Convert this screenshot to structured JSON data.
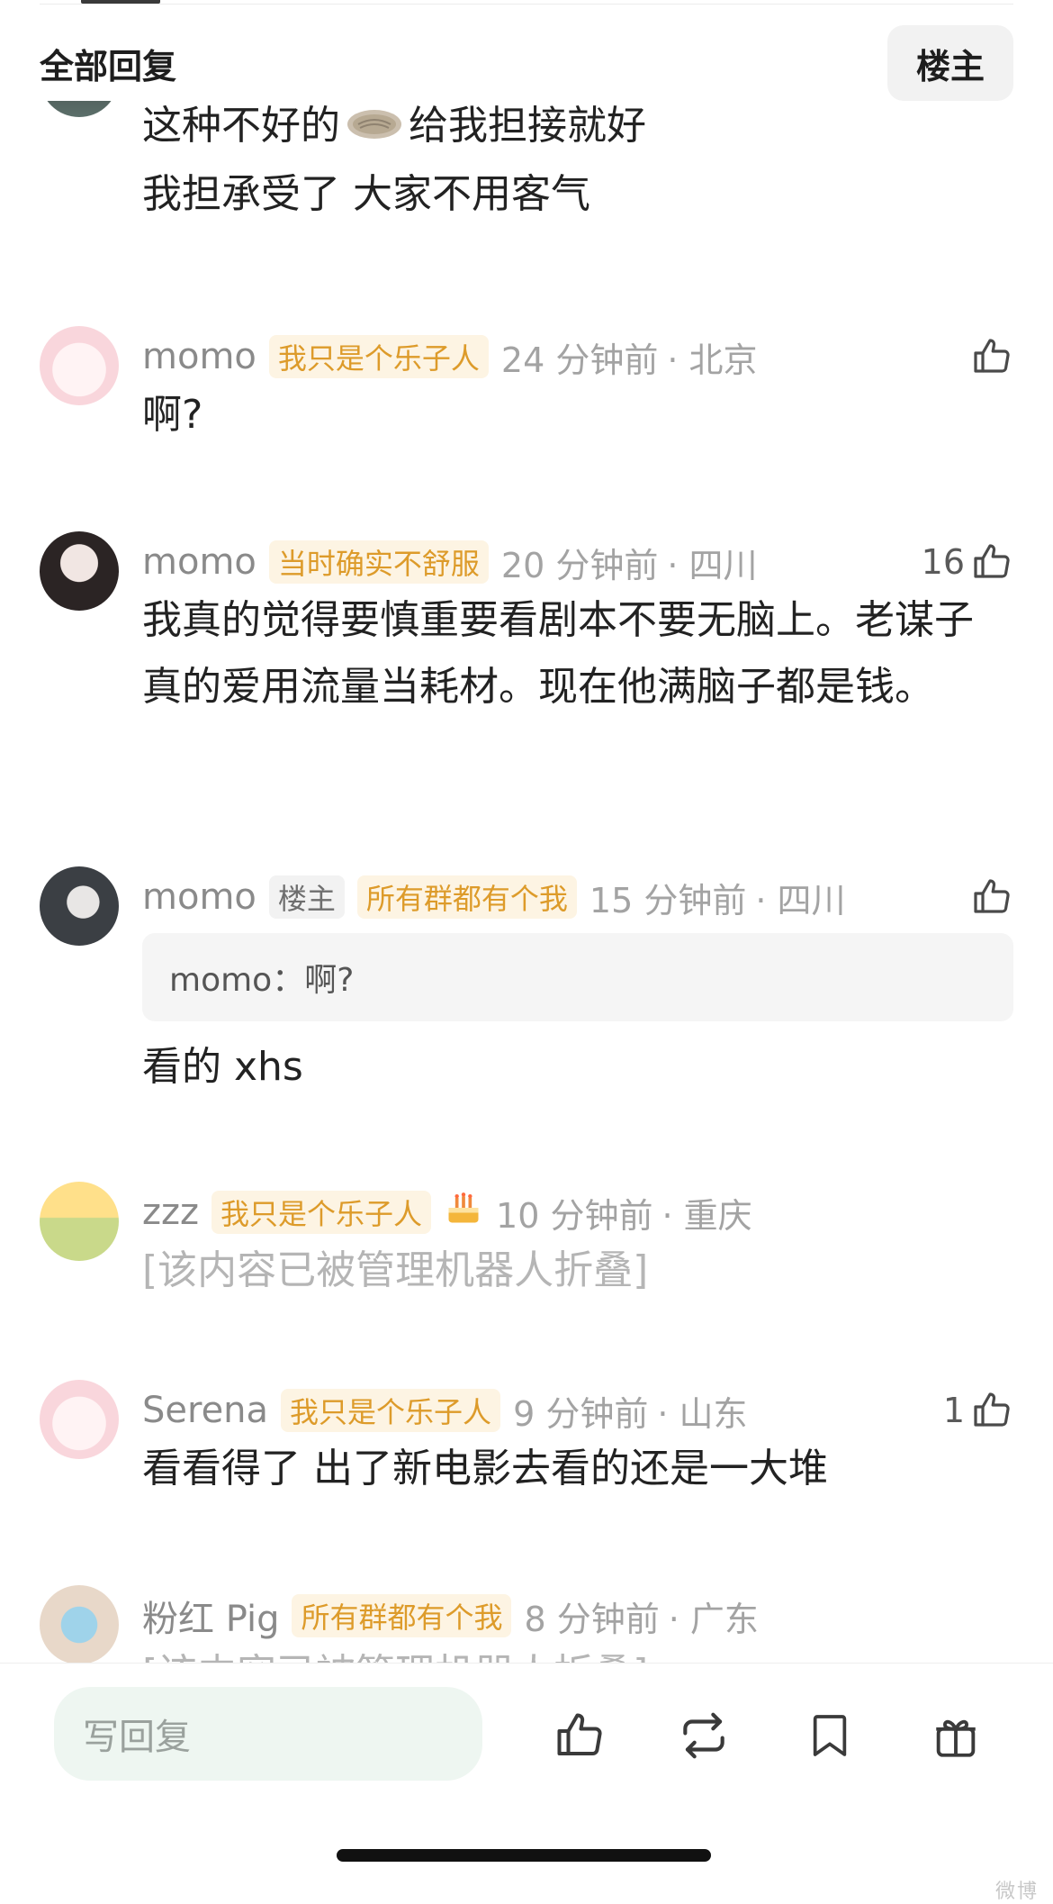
{
  "header": {
    "title": "全部回复",
    "filter_label": "楼主"
  },
  "comments": [
    {
      "author": "",
      "lines": [
        "这种不好的",
        "给我担接就好",
        "我担承受了 大家不用客气"
      ],
      "emoji": "flatbread-emoji"
    },
    {
      "author": "momo",
      "badge": "我只是个乐子人",
      "time": "24 分钟前",
      "location": "· 北京",
      "likes": "",
      "text": "啊?"
    },
    {
      "author": "momo",
      "badge": "当时确实不舒服",
      "time": "20 分钟前",
      "location": "· 四川",
      "likes": "16",
      "text": "我真的觉得要慎重要看剧本不要无脑上。老谋子真的爱用流量当耗材。现在他满脑子都是钱。"
    },
    {
      "author": "momo",
      "op_badge": "楼主",
      "badge": "所有群都有个我",
      "time": "15 分钟前",
      "location": "· 四川",
      "likes": "",
      "quote": "momo：啊?",
      "text": "看的 xhs"
    },
    {
      "author": "zzz",
      "badge": "我只是个乐子人",
      "badge_icon": "cake-icon",
      "time": "10 分钟前",
      "location": "· 重庆",
      "likes": "",
      "text": "[该内容已被管理机器人折叠]"
    },
    {
      "author": "Serena",
      "badge": "我只是个乐子人",
      "time": "9 分钟前",
      "location": "· 山东",
      "likes": "1",
      "text": "看看得了 出了新电影去看的还是一大堆"
    },
    {
      "author": "粉红 Pig",
      "badge": "所有群都有个我",
      "time": "8 分钟前",
      "location": "· 广东",
      "likes": "",
      "text": "[该内容已被管理机器人折叠]"
    }
  ],
  "reply_bar": {
    "placeholder": "写回复",
    "icons": [
      "thumbs-up-icon",
      "repost-icon",
      "bookmark-icon",
      "gift-icon"
    ]
  },
  "watermark": "微博"
}
